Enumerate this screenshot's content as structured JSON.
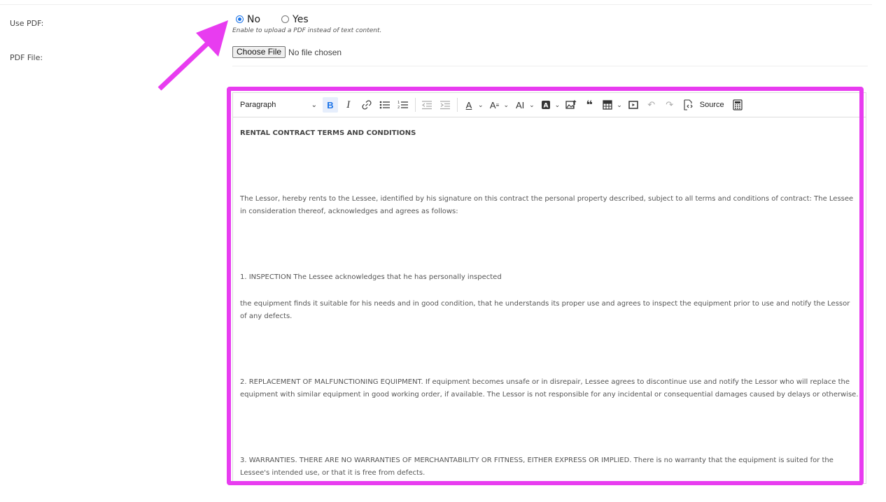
{
  "form": {
    "use_pdf": {
      "label": "Use PDF:",
      "options": [
        "No",
        "Yes"
      ],
      "selected": "No",
      "help": "Enable to upload a PDF instead of text content."
    },
    "pdf_file": {
      "label": "PDF File:",
      "button_label": "Choose File",
      "status": "No file chosen"
    }
  },
  "editor": {
    "toolbar": {
      "heading_select": "Paragraph",
      "source_label": "Source",
      "icons": [
        "bold-icon",
        "italic-icon",
        "link-icon",
        "bulleted-list-icon",
        "numbered-list-icon",
        "outdent-icon",
        "indent-icon",
        "font-color-icon",
        "font-size-icon",
        "text-transform-icon",
        "highlight-icon",
        "image-upload-icon",
        "blockquote-icon",
        "table-icon",
        "media-embed-icon",
        "undo-icon",
        "redo-icon",
        "source-icon",
        "calculator-icon"
      ]
    },
    "content": {
      "heading": "RENTAL CONTRACT TERMS AND CONDITIONS",
      "para1": "The Lessor, hereby rents to the Lessee, identified by his signature on this contract the personal property described, subject to all terms and conditions of contract: The Lessee in consideration thereof, acknowledges and agrees as follows:",
      "inspection": "1. INSPECTION The Lessee acknowledges that he has personally inspected",
      "para2": "the equipment finds it suitable for his needs and in good condition, that he understands its proper use and agrees to inspect the equipment prior to use and notify the Lessor of any defects.",
      "para3": "2. REPLACEMENT OF MALFUNCTIONING EQUIPMENT. If equipment becomes unsafe or in disrepair, Lessee agrees to discontinue use and notify the Lessor who will replace the equipment with similar equipment in good working order, if available. The Lessor is not responsible for any incidental or consequential damages caused by delays or otherwise.",
      "para4": "3. WARRANTIES. THERE ARE NO WARRANTIES OF MERCHANTABILITY OR FITNESS, EITHER EXPRESS OR IMPLIED. There is no warranty that the equipment is suited for the Lessee's intended use, or that it is free from defects."
    }
  },
  "colors": {
    "highlight": "#e83cf0",
    "accent": "#1a73e8"
  }
}
